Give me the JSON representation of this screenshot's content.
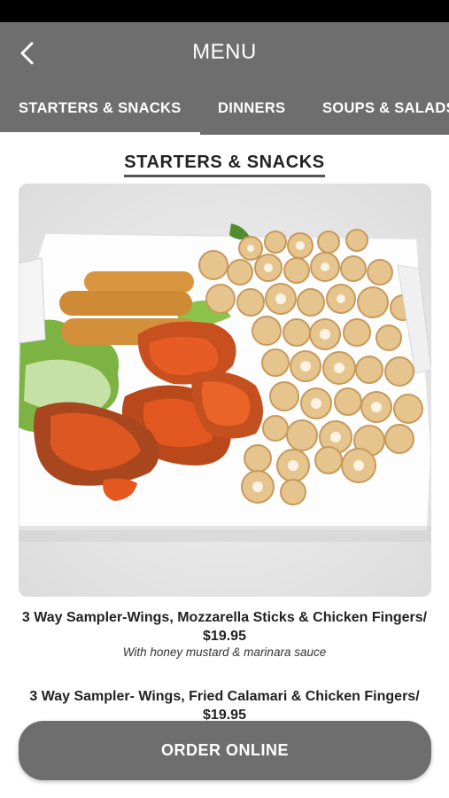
{
  "header": {
    "title": "MENU"
  },
  "tabs": [
    {
      "label": "STARTERS & SNACKS",
      "active": true
    },
    {
      "label": "DINNERS",
      "active": false
    },
    {
      "label": "SOUPS & SALADS",
      "active": false
    }
  ],
  "section": {
    "title": "STARTERS & SNACKS"
  },
  "items": [
    {
      "title": "3 Way Sampler-Wings, Mozzarella Sticks & Chicken Fingers/ $19.95",
      "description": "With honey mustard & marinara sauce"
    },
    {
      "title": "3 Way Sampler- Wings, Fried Calamari & Chicken Fingers/ $19.95"
    }
  ],
  "order_button": {
    "label": "ORDER ONLINE"
  },
  "colors": {
    "header_bg": "#6e6e6e",
    "button_bg": "#6e6e6e",
    "status_bar": "#000000"
  }
}
